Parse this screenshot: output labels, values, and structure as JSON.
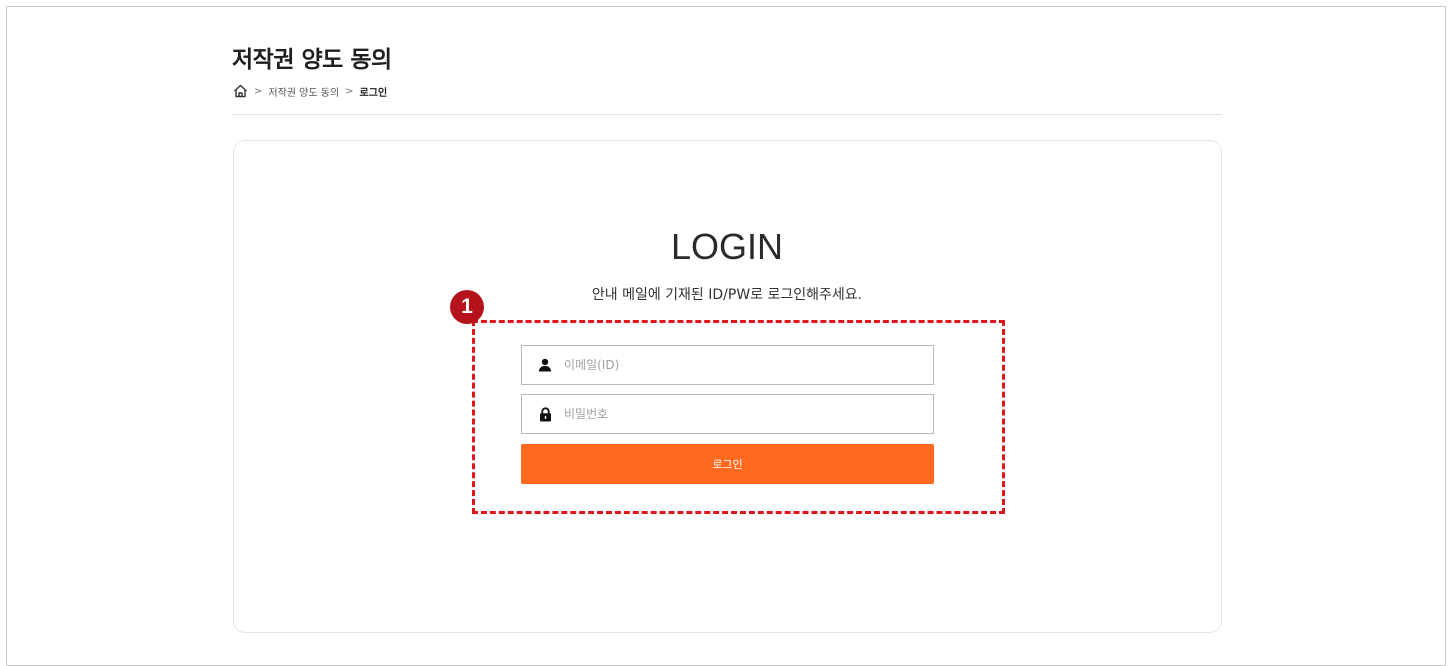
{
  "page": {
    "title": "저작권 양도 동의"
  },
  "breadcrumb": {
    "home_icon": "home-icon",
    "separator": ">",
    "items": [
      {
        "label": "저작권 양도 동의"
      },
      {
        "label": "로그인"
      }
    ]
  },
  "login": {
    "title": "LOGIN",
    "description": "안내 메일에 기재된 ID/PW로 로그인해주세요.",
    "email": {
      "placeholder": "이메일(ID)",
      "value": "",
      "icon": "user-icon"
    },
    "password": {
      "placeholder": "비밀번호",
      "value": "",
      "icon": "lock-icon"
    },
    "button_label": "로그인"
  },
  "callout": {
    "number": "1"
  },
  "colors": {
    "accent": "#ff6a20",
    "callout_border": "#e0161d",
    "callout_badge": "#b5121b"
  }
}
